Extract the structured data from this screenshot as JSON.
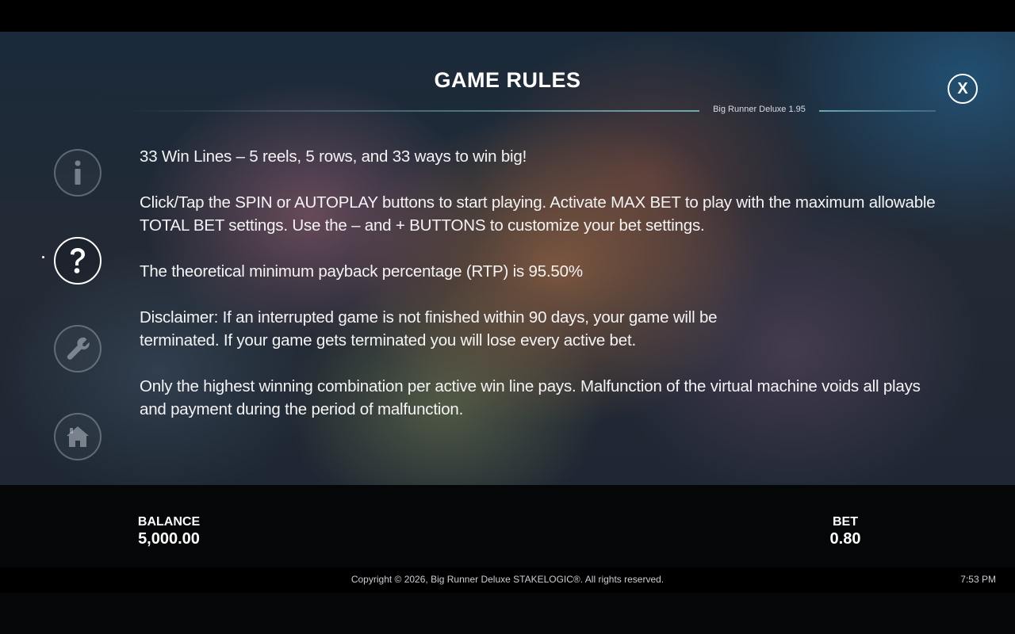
{
  "header": {
    "title": "GAME RULES",
    "version": "Big Runner Deluxe 1.95",
    "close_label": "X"
  },
  "sidebar": {
    "items": [
      {
        "name": "info",
        "icon": "info-icon",
        "active": false
      },
      {
        "name": "rules",
        "icon": "question-icon",
        "active": true
      },
      {
        "name": "settings",
        "icon": "wrench-icon",
        "active": false
      },
      {
        "name": "home",
        "icon": "home-icon",
        "active": false
      }
    ]
  },
  "rules": {
    "paragraphs": [
      "33 Win Lines – 5 reels, 5 rows, and 33 ways to win big!",
      "Click/Tap the SPIN or AUTOPLAY buttons to start playing. Activate MAX BET to play with the maximum allowable TOTAL BET settings. Use the – and + BUTTONS to customize your bet settings.",
      "The theoretical minimum payback percentage (RTP) is 95.50%",
      "Disclaimer: If an interrupted game is not finished within 90 days, your game will be terminated. If your game gets terminated you will lose every active bet.",
      "Only the highest winning combination per active win line pays. Malfunction of the virtual machine voids all plays and payment during the period of malfunction."
    ]
  },
  "status": {
    "balance_label": "BALANCE",
    "balance_value": "5,000.00",
    "bet_label": "BET",
    "bet_value": "0.80"
  },
  "footer": {
    "copyright": "Copyright © 2026, Big Runner Deluxe STAKELOGIC®. All rights reserved.",
    "time": "7:53 PM"
  },
  "colors": {
    "rule_line": "#78bec8",
    "panel_dark": "#1e2733",
    "bottom_bar": "#050607"
  }
}
